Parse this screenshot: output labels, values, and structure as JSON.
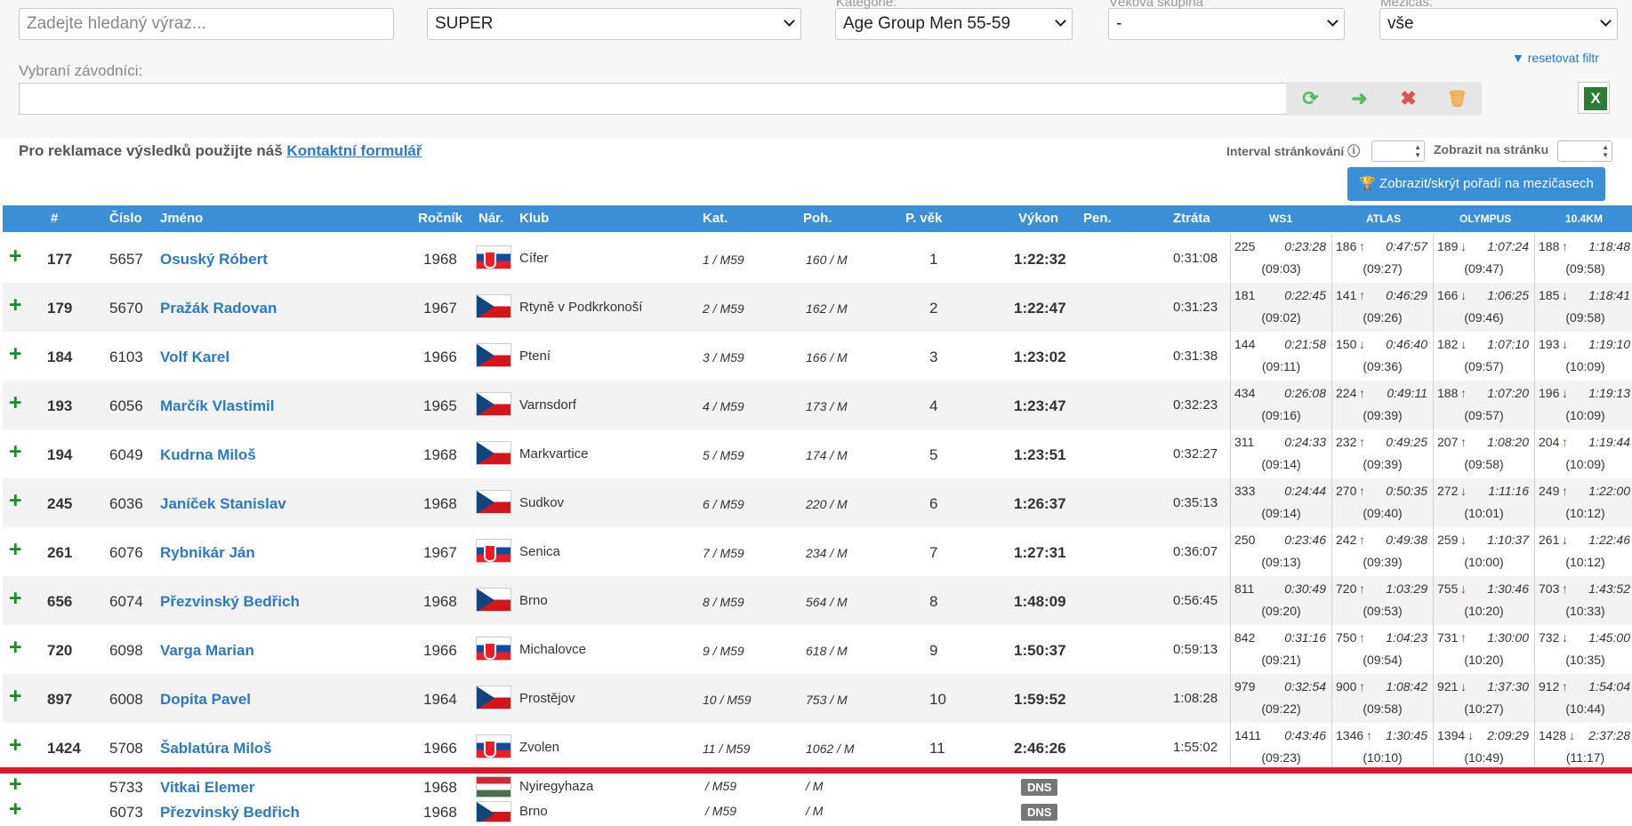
{
  "filters": {
    "search_placeholder": "Zadejte hledaný výraz...",
    "race_select": "SUPER",
    "category_label": "Kategorie:",
    "category_select": "Age Group Men 55-59",
    "age_group_label": "Věková skupina",
    "age_group_select": "-",
    "split_label": "Mezičas:",
    "split_select": "vše",
    "reset_link": "resetovat filtr",
    "selected_label": "Vybraní závodníci:"
  },
  "notice": {
    "text": "Pro reklamace výsledků použijte náš ",
    "link": "Kontaktní formulář"
  },
  "paging": {
    "interval_label": "Interval stránkování",
    "per_page_label": "Zobrazit na stránku",
    "toggle_button": "Zobrazit/skrýt pořadí na mezičasech"
  },
  "headers": {
    "rank": "#",
    "bib": "Číslo",
    "name": "Jméno",
    "year": "Ročník",
    "nation": "Nár.",
    "club": "Klub",
    "cat": "Kat.",
    "gender": "Poh.",
    "age_rank": "P. věk",
    "result": "Výkon",
    "penalty": "Pen.",
    "loss": "Ztráta",
    "splits": [
      "WS1",
      "ATLAS",
      "OLYMPUS",
      "10.4KM"
    ]
  },
  "rows": [
    {
      "rank": "177",
      "bib": "5657",
      "name": "Osuský Róbert",
      "year": "1968",
      "flag": "sk",
      "club": "Cífer",
      "cat": "1 / M59",
      "gender": "160 / M",
      "age": "1",
      "result": "1:22:32",
      "loss": "0:31:08",
      "splits": [
        {
          "pos": "225",
          "dir": "",
          "time": "0:23:28",
          "pace": "(09:03)"
        },
        {
          "pos": "186",
          "dir": "up",
          "time": "0:47:57",
          "pace": "(09:27)"
        },
        {
          "pos": "189",
          "dir": "down",
          "time": "1:07:24",
          "pace": "(09:47)"
        },
        {
          "pos": "188",
          "dir": "up",
          "time": "1:18:48",
          "pace": "(09:58)"
        }
      ]
    },
    {
      "rank": "179",
      "bib": "5670",
      "name": "Pražák Radovan",
      "year": "1967",
      "flag": "cz",
      "club": "Rtyně v Podkrkonoší",
      "cat": "2 / M59",
      "gender": "162 / M",
      "age": "2",
      "result": "1:22:47",
      "loss": "0:31:23",
      "splits": [
        {
          "pos": "181",
          "dir": "",
          "time": "0:22:45",
          "pace": "(09:02)"
        },
        {
          "pos": "141",
          "dir": "up",
          "time": "0:46:29",
          "pace": "(09:26)"
        },
        {
          "pos": "166",
          "dir": "down",
          "time": "1:06:25",
          "pace": "(09:46)"
        },
        {
          "pos": "185",
          "dir": "down",
          "time": "1:18:41",
          "pace": "(09:58)"
        }
      ]
    },
    {
      "rank": "184",
      "bib": "6103",
      "name": "Volf Karel",
      "year": "1966",
      "flag": "cz",
      "club": "Ptení",
      "cat": "3 / M59",
      "gender": "166 / M",
      "age": "3",
      "result": "1:23:02",
      "loss": "0:31:38",
      "splits": [
        {
          "pos": "144",
          "dir": "",
          "time": "0:21:58",
          "pace": "(09:11)"
        },
        {
          "pos": "150",
          "dir": "down",
          "time": "0:46:40",
          "pace": "(09:36)"
        },
        {
          "pos": "182",
          "dir": "down",
          "time": "1:07:10",
          "pace": "(09:57)"
        },
        {
          "pos": "193",
          "dir": "down",
          "time": "1:19:10",
          "pace": "(10:09)"
        }
      ]
    },
    {
      "rank": "193",
      "bib": "6056",
      "name": "Marčík Vlastimil",
      "year": "1965",
      "flag": "cz",
      "club": "Varnsdorf",
      "cat": "4 / M59",
      "gender": "173 / M",
      "age": "4",
      "result": "1:23:47",
      "loss": "0:32:23",
      "splits": [
        {
          "pos": "434",
          "dir": "",
          "time": "0:26:08",
          "pace": "(09:16)"
        },
        {
          "pos": "224",
          "dir": "up",
          "time": "0:49:11",
          "pace": "(09:39)"
        },
        {
          "pos": "188",
          "dir": "up",
          "time": "1:07:20",
          "pace": "(09:57)"
        },
        {
          "pos": "196",
          "dir": "down",
          "time": "1:19:13",
          "pace": "(10:09)"
        }
      ]
    },
    {
      "rank": "194",
      "bib": "6049",
      "name": "Kudrna Miloš",
      "year": "1968",
      "flag": "cz",
      "club": "Markvartice",
      "cat": "5 / M59",
      "gender": "174 / M",
      "age": "5",
      "result": "1:23:51",
      "loss": "0:32:27",
      "splits": [
        {
          "pos": "311",
          "dir": "",
          "time": "0:24:33",
          "pace": "(09:14)"
        },
        {
          "pos": "232",
          "dir": "up",
          "time": "0:49:25",
          "pace": "(09:39)"
        },
        {
          "pos": "207",
          "dir": "up",
          "time": "1:08:20",
          "pace": "(09:58)"
        },
        {
          "pos": "204",
          "dir": "up",
          "time": "1:19:44",
          "pace": "(10:09)"
        }
      ]
    },
    {
      "rank": "245",
      "bib": "6036",
      "name": "Janíček Stanislav",
      "year": "1968",
      "flag": "cz",
      "club": "Sudkov",
      "cat": "6 / M59",
      "gender": "220 / M",
      "age": "6",
      "result": "1:26:37",
      "loss": "0:35:13",
      "splits": [
        {
          "pos": "333",
          "dir": "",
          "time": "0:24:44",
          "pace": "(09:14)"
        },
        {
          "pos": "270",
          "dir": "up",
          "time": "0:50:35",
          "pace": "(09:40)"
        },
        {
          "pos": "272",
          "dir": "down",
          "time": "1:11:16",
          "pace": "(10:01)"
        },
        {
          "pos": "249",
          "dir": "up",
          "time": "1:22:00",
          "pace": "(10:12)"
        }
      ]
    },
    {
      "rank": "261",
      "bib": "6076",
      "name": "Rybnikár Ján",
      "year": "1967",
      "flag": "sk",
      "club": "Senica",
      "cat": "7 / M59",
      "gender": "234 / M",
      "age": "7",
      "result": "1:27:31",
      "loss": "0:36:07",
      "splits": [
        {
          "pos": "250",
          "dir": "",
          "time": "0:23:46",
          "pace": "(09:13)"
        },
        {
          "pos": "242",
          "dir": "up",
          "time": "0:49:38",
          "pace": "(09:39)"
        },
        {
          "pos": "259",
          "dir": "down",
          "time": "1:10:37",
          "pace": "(10:00)"
        },
        {
          "pos": "261",
          "dir": "down",
          "time": "1:22:46",
          "pace": "(10:12)"
        }
      ]
    },
    {
      "rank": "656",
      "bib": "6074",
      "name": "Přezvinský Bedřich",
      "year": "1968",
      "flag": "cz",
      "club": "Brno",
      "cat": "8 / M59",
      "gender": "564 / M",
      "age": "8",
      "result": "1:48:09",
      "loss": "0:56:45",
      "splits": [
        {
          "pos": "811",
          "dir": "",
          "time": "0:30:49",
          "pace": "(09:20)"
        },
        {
          "pos": "720",
          "dir": "up",
          "time": "1:03:29",
          "pace": "(09:53)"
        },
        {
          "pos": "755",
          "dir": "down",
          "time": "1:30:46",
          "pace": "(10:20)"
        },
        {
          "pos": "703",
          "dir": "up",
          "time": "1:43:52",
          "pace": "(10:33)"
        }
      ]
    },
    {
      "rank": "720",
      "bib": "6098",
      "name": "Varga Marian",
      "year": "1966",
      "flag": "sk",
      "club": "Michalovce",
      "cat": "9 / M59",
      "gender": "618 / M",
      "age": "9",
      "result": "1:50:37",
      "loss": "0:59:13",
      "splits": [
        {
          "pos": "842",
          "dir": "",
          "time": "0:31:16",
          "pace": "(09:21)"
        },
        {
          "pos": "750",
          "dir": "up",
          "time": "1:04:23",
          "pace": "(09:54)"
        },
        {
          "pos": "731",
          "dir": "up",
          "time": "1:30:00",
          "pace": "(10:20)"
        },
        {
          "pos": "732",
          "dir": "down",
          "time": "1:45:00",
          "pace": "(10:35)"
        }
      ]
    },
    {
      "rank": "897",
      "bib": "6008",
      "name": "Dopita Pavel",
      "year": "1964",
      "flag": "cz",
      "club": "Prostějov",
      "cat": "10 / M59",
      "gender": "753 / M",
      "age": "10",
      "result": "1:59:52",
      "loss": "1:08:28",
      "splits": [
        {
          "pos": "979",
          "dir": "",
          "time": "0:32:54",
          "pace": "(09:22)"
        },
        {
          "pos": "900",
          "dir": "up",
          "time": "1:08:42",
          "pace": "(09:58)"
        },
        {
          "pos": "921",
          "dir": "down",
          "time": "1:37:30",
          "pace": "(10:27)"
        },
        {
          "pos": "912",
          "dir": "up",
          "time": "1:54:04",
          "pace": "(10:44)"
        }
      ]
    },
    {
      "rank": "1424",
      "bib": "5708",
      "name": "Šablatúra Miloš",
      "year": "1966",
      "flag": "sk",
      "club": "Zvolen",
      "cat": "11 / M59",
      "gender": "1062 / M",
      "age": "11",
      "result": "2:46:26",
      "loss": "1:55:02",
      "splits": [
        {
          "pos": "1411",
          "dir": "",
          "time": "0:43:46",
          "pace": "(09:23)"
        },
        {
          "pos": "1346",
          "dir": "up",
          "time": "1:30:45",
          "pace": "(10:10)"
        },
        {
          "pos": "1394",
          "dir": "down",
          "time": "2:09:29",
          "pace": "(10:49)"
        },
        {
          "pos": "1428",
          "dir": "down",
          "time": "2:37:28",
          "pace": "(11:17)"
        }
      ]
    }
  ],
  "dns_rows": [
    {
      "bib": "5733",
      "name": "Vitkai Elemer",
      "year": "1968",
      "flag": "hu",
      "club": "Nyiregyhaza",
      "cat": "/ M59",
      "gender": "/ M",
      "status": "DNS"
    },
    {
      "bib": "6073",
      "name": "Přezvinský Bedřich",
      "year": "1968",
      "flag": "cz",
      "club": "Brno",
      "cat": "/ M59",
      "gender": "/ M",
      "status": "DNS"
    }
  ],
  "colors": {
    "header": "#3a8fd6",
    "link": "#2a7ac4",
    "plus": "#1d8a2a",
    "divider": "#e0162b"
  },
  "icons": {
    "refresh": "refresh-icon",
    "arrow": "arrow-right-icon",
    "remove": "close-icon",
    "trash": "trash-icon",
    "excel": "excel-icon"
  }
}
